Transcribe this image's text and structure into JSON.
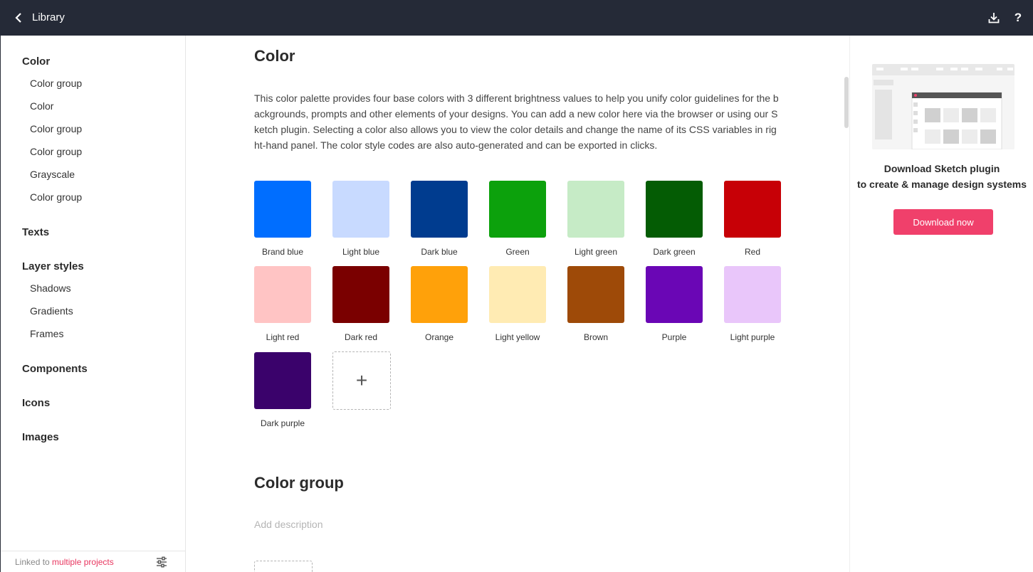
{
  "topbar": {
    "title": "Library",
    "back_icon": "chevron-left-icon",
    "download_icon": "download-icon",
    "help_label": "?"
  },
  "sidebar": {
    "sections": [
      {
        "label": "Color",
        "children": [
          "Color group",
          "Color",
          "Color group",
          "Color group",
          "Grayscale",
          "Color group"
        ]
      },
      {
        "label": "Texts",
        "children": []
      },
      {
        "label": "Layer styles",
        "children": [
          "Shadows",
          "Gradients",
          "Frames"
        ]
      },
      {
        "label": "Components",
        "children": []
      },
      {
        "label": "Icons",
        "children": []
      },
      {
        "label": "Images",
        "children": []
      }
    ],
    "footer": {
      "prefix": "Linked to ",
      "link": "multiple projects",
      "settings_icon": "sliders-icon"
    }
  },
  "main": {
    "section1": {
      "title": "Color",
      "description": "This color palette provides four base colors with 3 different brightness values to help you unify color guidelines for the backgrounds, prompts and other elements of your designs. You can add a new color here via the browser or using our Sketch plugin. Selecting a color also allows you to view the color details and change the name of its CSS variables in right-hand panel. The color style codes are also auto-generated and can be exported in clicks."
    },
    "swatches": [
      {
        "name": "Brand blue",
        "color": "#006eff"
      },
      {
        "name": "Light blue",
        "color": "#c8daff"
      },
      {
        "name": "Dark blue",
        "color": "#003c8f"
      },
      {
        "name": "Green",
        "color": "#0ca10c"
      },
      {
        "name": "Light green",
        "color": "#c6ebc6"
      },
      {
        "name": "Dark green",
        "color": "#045c04"
      },
      {
        "name": "Red",
        "color": "#c70006"
      },
      {
        "name": "Light red",
        "color": "#ffc4c4"
      },
      {
        "name": "Dark red",
        "color": "#7a0000"
      },
      {
        "name": "Orange",
        "color": "#ffa10a"
      },
      {
        "name": "Light yellow",
        "color": "#ffebb3"
      },
      {
        "name": "Brown",
        "color": "#9e4a08"
      },
      {
        "name": "Purple",
        "color": "#6a06b5"
      },
      {
        "name": "Light purple",
        "color": "#e9c6fa"
      },
      {
        "name": "Dark purple",
        "color": "#3a026b"
      }
    ],
    "add_label": "+",
    "section2": {
      "title": "Color group",
      "placeholder": "Add description"
    }
  },
  "promo": {
    "line1": "Download Sketch plugin",
    "line2": "to create & manage design systems",
    "button": "Download now"
  }
}
